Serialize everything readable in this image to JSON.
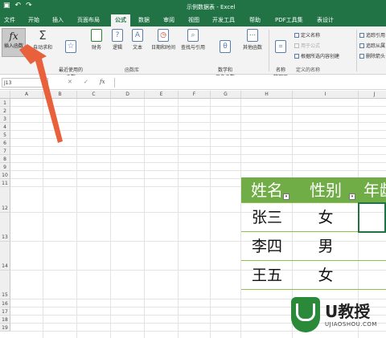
{
  "titlebar": {
    "title": "示例数据表  -  Excel",
    "qa_icons": [
      "save-icon",
      "undo-icon",
      "redo-icon"
    ]
  },
  "menu": {
    "tabs": [
      "文件",
      "开始",
      "插入",
      "页面布局",
      "公式",
      "数据",
      "审阅",
      "视图",
      "开发工具",
      "帮助",
      "PDF工具集",
      "表设计"
    ],
    "active": "公式"
  },
  "ribbon": {
    "insert_function": "插入函数",
    "buttons": [
      {
        "label": "自动求和",
        "icon": "sigma-icon"
      },
      {
        "label": "最近使用的\n函数",
        "icon": "star-icon"
      },
      {
        "label": "财务",
        "icon": "book-icon"
      },
      {
        "label": "逻辑",
        "icon": "question-icon"
      },
      {
        "label": "文本",
        "icon": "text-icon"
      },
      {
        "label": "日期和时间",
        "icon": "clock-icon"
      },
      {
        "label": "查找与引用",
        "icon": "search-icon"
      },
      {
        "label": "数学和\n三角函数",
        "icon": "theta-icon"
      },
      {
        "label": "其他函数",
        "icon": "more-icon"
      }
    ],
    "group_library": "函数库",
    "name_manager": "名称\n管理器",
    "define_name": "定义名称",
    "use_in_formula": "用于公式",
    "create_from_selection": "根据所选内容创建",
    "group_defined_names": "定义的名称",
    "trace_precedents": "追踪引用",
    "trace_dependents": "追踪从属",
    "remove_arrows": "删除箭头"
  },
  "formula_bar": {
    "namebox": "J13",
    "cancel": "✕",
    "enter": "✓",
    "fx": "fx",
    "value": ""
  },
  "grid": {
    "columns": [
      "A",
      "B",
      "C",
      "D",
      "E",
      "F",
      "G",
      "H",
      "I",
      "J"
    ],
    "rows": [
      "1",
      "2",
      "3",
      "4",
      "5",
      "6",
      "7",
      "8",
      "9",
      "10",
      "11",
      "12",
      "13",
      "14",
      "15",
      "16",
      "17",
      "18",
      "19"
    ]
  },
  "table": {
    "headers": [
      "姓名",
      "性别",
      "年龄"
    ],
    "rows": [
      [
        "张三",
        "女"
      ],
      [
        "李四",
        "男"
      ],
      [
        "王五",
        "女"
      ]
    ],
    "header_color": "#70ad47"
  },
  "watermark": {
    "brand": "U教授",
    "url": "UJIAOSHOU.COM"
  },
  "colors": {
    "excel_green": "#217346",
    "arrow": "#e8603c"
  }
}
